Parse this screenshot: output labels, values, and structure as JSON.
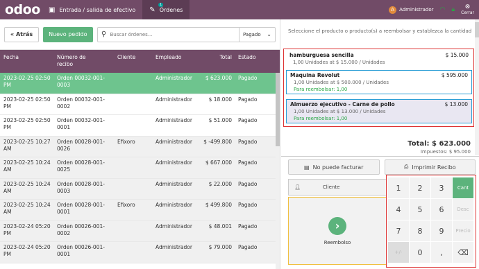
{
  "topbar": {
    "logo": "odoo",
    "nav": [
      {
        "label": "Entrada / salida de efectivo",
        "icon": "cash-icon"
      },
      {
        "label": "Órdenes",
        "icon": "orders-icon",
        "badge": "1"
      }
    ],
    "user": {
      "initial": "A",
      "name": "Administrador"
    },
    "close_label": "Cerrar"
  },
  "toolbar": {
    "back_label": "« Atrás",
    "new_label": "Nuevo pedido",
    "search_placeholder": "Buscar órdenes...",
    "filter_label": "Pagado"
  },
  "table": {
    "headers": {
      "date": "Fecha",
      "number": "Número de recibo",
      "client": "Cliente",
      "employee": "Empleado",
      "total": "Total",
      "state": "Estado"
    },
    "rows": [
      {
        "date": "2023-02-25 02:50 PM",
        "number": "Orden 00032-001-0003",
        "client": "",
        "employee": "Administrador",
        "total": "$ 623.000",
        "state": "Pagado"
      },
      {
        "date": "2023-02-25 02:50 PM",
        "number": "Orden 00032-001-0002",
        "client": "",
        "employee": "Administrador",
        "total": "$ 18.000",
        "state": "Pagado"
      },
      {
        "date": "2023-02-25 02:50 PM",
        "number": "Orden 00032-001-0001",
        "client": "",
        "employee": "Administrador",
        "total": "$ 51.000",
        "state": "Pagado"
      },
      {
        "date": "2023-02-25 10:27 AM",
        "number": "Orden 00028-001-0026",
        "client": "Efixoro",
        "employee": "Administrador",
        "total": "$ -499.800",
        "state": "Pagado"
      },
      {
        "date": "2023-02-25 10:24 AM",
        "number": "Orden 00028-001-0025",
        "client": "",
        "employee": "Administrador",
        "total": "$ 667.000",
        "state": "Pagado"
      },
      {
        "date": "2023-02-25 10:24 AM",
        "number": "Orden 00028-001-0003",
        "client": "",
        "employee": "Administrador",
        "total": "$ 22.000",
        "state": "Pagado"
      },
      {
        "date": "2023-02-25 10:24 AM",
        "number": "Orden 00028-001-0001",
        "client": "Efixoro",
        "employee": "Administrador",
        "total": "$ 499.800",
        "state": "Pagado"
      },
      {
        "date": "2023-02-24 05:20 PM",
        "number": "Orden 00026-001-0002",
        "client": "",
        "employee": "Administrador",
        "total": "$ 48.001",
        "state": "Pagado"
      },
      {
        "date": "2023-02-24 05:20 PM",
        "number": "Orden 00026-001-0001",
        "client": "",
        "employee": "Administrador",
        "total": "$ 79.000",
        "state": "Pagado"
      }
    ]
  },
  "refund": {
    "instruction": "Seleccione el producto o producto(s) a reembolsar y establezca la cantidad",
    "lines": [
      {
        "name": "hamburguesa sencilla",
        "price": "$ 15.000",
        "detail": "1,00 Unidades at $ 15.000 / Unidades",
        "refund": ""
      },
      {
        "name": "Maquina Revolut",
        "price": "$ 595.000",
        "detail": "1,00 Unidades at $ 500.000 / Unidades",
        "refund": "Para reembolsar: 1,00"
      },
      {
        "name": "Almuerzo ejecutivo - Carne de pollo",
        "price": "$ 13.000",
        "detail": "1,00 Unidades at $ 13.000 / Unidades",
        "refund": "Para reembolsar: 1,00"
      }
    ],
    "total": "Total: $ 623.000",
    "taxes": "Impuestos: $ 95.000"
  },
  "actions": {
    "invoice_label": "No puede facturar",
    "print_label": "Imprimir Recibo",
    "client_label": "Cliente",
    "refund_label": "Reembolso"
  },
  "numpad": {
    "keys": [
      "1",
      "2",
      "3",
      "Cant",
      "4",
      "5",
      "6",
      "Desc",
      "7",
      "8",
      "9",
      "Precio",
      "+/-",
      "0",
      ",",
      "⌫"
    ]
  }
}
